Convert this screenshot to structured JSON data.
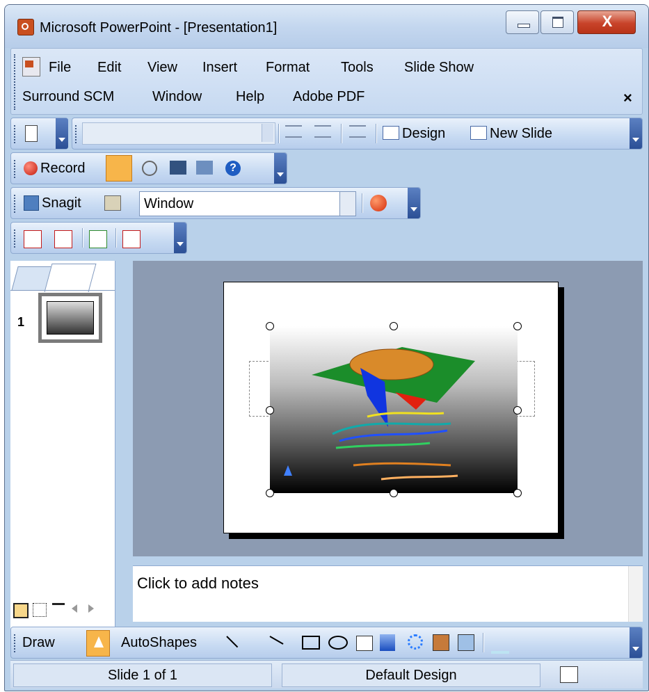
{
  "window": {
    "title": "Microsoft PowerPoint - [Presentation1]"
  },
  "menu": {
    "items": [
      "File",
      "Edit",
      "View",
      "Insert",
      "Format",
      "Tools",
      "Slide Show",
      "Surround SCM",
      "Window",
      "Help",
      "Adobe PDF"
    ],
    "close_glyph": "×"
  },
  "toolbar_formatting": {
    "design_label": "Design",
    "new_slide_label": "New Slide",
    "font_box_value": ""
  },
  "toolbar_record": {
    "record_label": "Record"
  },
  "toolbar_snagit": {
    "snagit_label": "Snagit",
    "capture_mode_value": "Window"
  },
  "left_pane": {
    "slide_number": "1"
  },
  "notes": {
    "placeholder": "Click to add notes"
  },
  "drawing_toolbar": {
    "draw_label": "Draw",
    "autoshapes_label": "AutoShapes"
  },
  "status": {
    "slide_info": "Slide 1 of 1",
    "design_name": "Default Design"
  },
  "colors": {
    "accent": "#f7b54a",
    "frame": "#b9d1ea",
    "slide_bg": "#8c9bb2"
  },
  "icons": [
    "app-icon",
    "document-icon",
    "new-document-icon",
    "numbering-icon",
    "bullets-icon",
    "indent-icon",
    "design-icon",
    "new-slide-icon",
    "record-icon",
    "pen-icon",
    "webcam-icon",
    "screen-icon",
    "presenter-icon",
    "help-icon",
    "snagit-icon",
    "snagit-profile-icon",
    "capture-icon",
    "pdf-icon",
    "pdf-comment-icon",
    "pdf-review-icon",
    "pdf-attach-icon",
    "outline-tab-icon",
    "slides-tab-icon",
    "normal-view-icon",
    "sorter-view-icon",
    "slideshow-view-icon",
    "select-arrow-icon",
    "line-icon",
    "arrow-icon",
    "rectangle-icon",
    "oval-icon",
    "textbox-icon",
    "wordart-icon",
    "diagram-icon",
    "clipart-icon",
    "picture-icon",
    "fill-color-icon",
    "spelling-icon"
  ]
}
